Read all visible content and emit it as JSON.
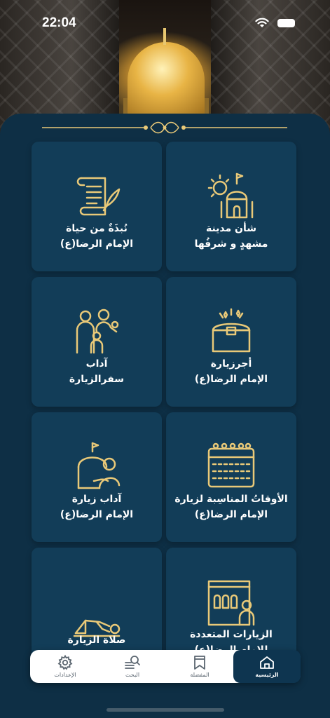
{
  "status_bar": {
    "time": "22:04"
  },
  "cards": [
    {
      "line1": "شأن مدينة",
      "line2": "مشهدٍ و شرفُها",
      "icon": "city-dome-sun-icon"
    },
    {
      "line1": "نُبذَةٌ من حياة",
      "line2": "الإمام الرضا(ع)",
      "icon": "scroll-quill-icon"
    },
    {
      "line1": "أجرزيارة",
      "line2": "الإمام الرضا(ع)",
      "icon": "treasure-chest-icon"
    },
    {
      "line1": "آداب",
      "line2": "سفرالزيارة",
      "icon": "family-travel-icon"
    },
    {
      "line1": "الأوقاتُ المناسِبة لزيارة",
      "line2": "الإمام الرضا(ع)",
      "icon": "calendar-icon"
    },
    {
      "line1": "آداب زيارة",
      "line2": "الإمام الرضا(ع)",
      "icon": "shrine-hug-icon"
    },
    {
      "line1": "الزيارات المتعددة",
      "line2": "للامام الرضا(ع)",
      "icon": "shrine-building-icon"
    },
    {
      "line1": "صلاة الزيارة",
      "line2": "",
      "icon": "prayer-prostration-icon"
    }
  ],
  "tabbar": {
    "items": [
      {
        "label": "الرئيسية",
        "icon": "home-icon",
        "active": true
      },
      {
        "label": "المفضلة",
        "icon": "bookmark-icon",
        "active": false
      },
      {
        "label": "البحث",
        "icon": "search-icon",
        "active": false
      },
      {
        "label": "الإعدادات",
        "icon": "gear-icon",
        "active": false
      }
    ]
  },
  "colors": {
    "background": "#0b2a3e",
    "card": "#123d58",
    "gold": "#e9c978",
    "tab_active": "#0e3550"
  }
}
